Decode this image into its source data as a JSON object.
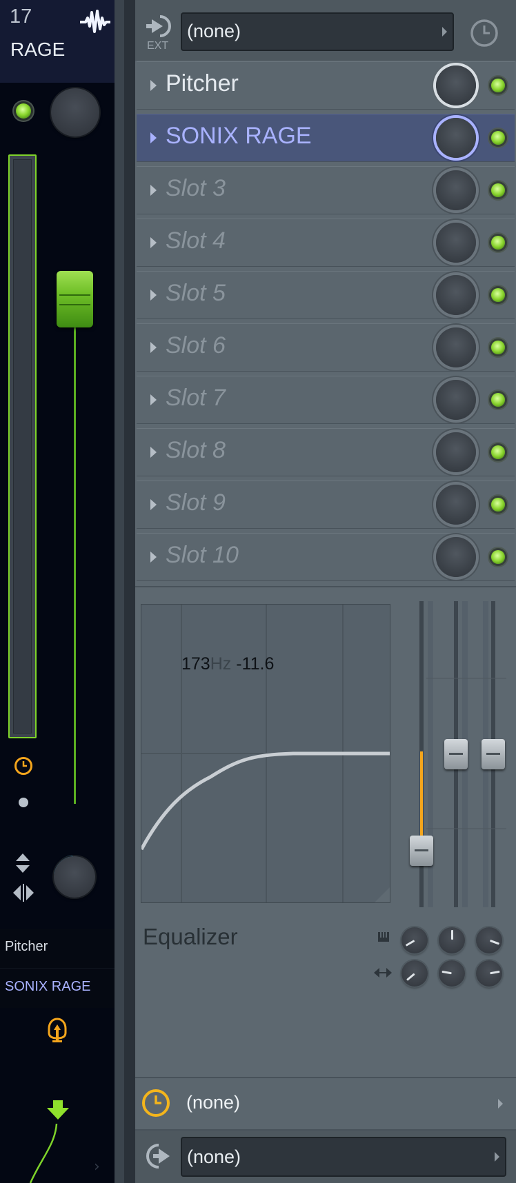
{
  "channel": {
    "number": "17",
    "name": "RAGE",
    "routes": [
      "Pitcher",
      "SONIX RAGE"
    ],
    "colors": {
      "accent_green": "#7fd42a",
      "active_purple": "#a9b2ff",
      "clock_orange": "#f4a51c"
    }
  },
  "panel": {
    "ext_label": "EXT",
    "input_select": "(none)",
    "slots": [
      {
        "label": "Pitcher",
        "loaded": true,
        "active": false
      },
      {
        "label": "SONIX RAGE",
        "loaded": true,
        "active": true
      },
      {
        "label": "Slot 3",
        "loaded": false,
        "active": false
      },
      {
        "label": "Slot 4",
        "loaded": false,
        "active": false
      },
      {
        "label": "Slot 5",
        "loaded": false,
        "active": false
      },
      {
        "label": "Slot 6",
        "loaded": false,
        "active": false
      },
      {
        "label": "Slot 7",
        "loaded": false,
        "active": false
      },
      {
        "label": "Slot 8",
        "loaded": false,
        "active": false
      },
      {
        "label": "Slot 9",
        "loaded": false,
        "active": false
      },
      {
        "label": "Slot 10",
        "loaded": false,
        "active": false
      }
    ],
    "eq": {
      "title": "Equalizer",
      "readout_freq": "173",
      "readout_unit": "Hz",
      "readout_gain": "-11.6"
    },
    "time_select": "(none)",
    "output_select": "(none)"
  },
  "icons": {
    "wave": "waveform-icon",
    "ext": "ext-input-icon",
    "clock": "clock-icon",
    "output": "output-icon",
    "send": "send-icon"
  }
}
